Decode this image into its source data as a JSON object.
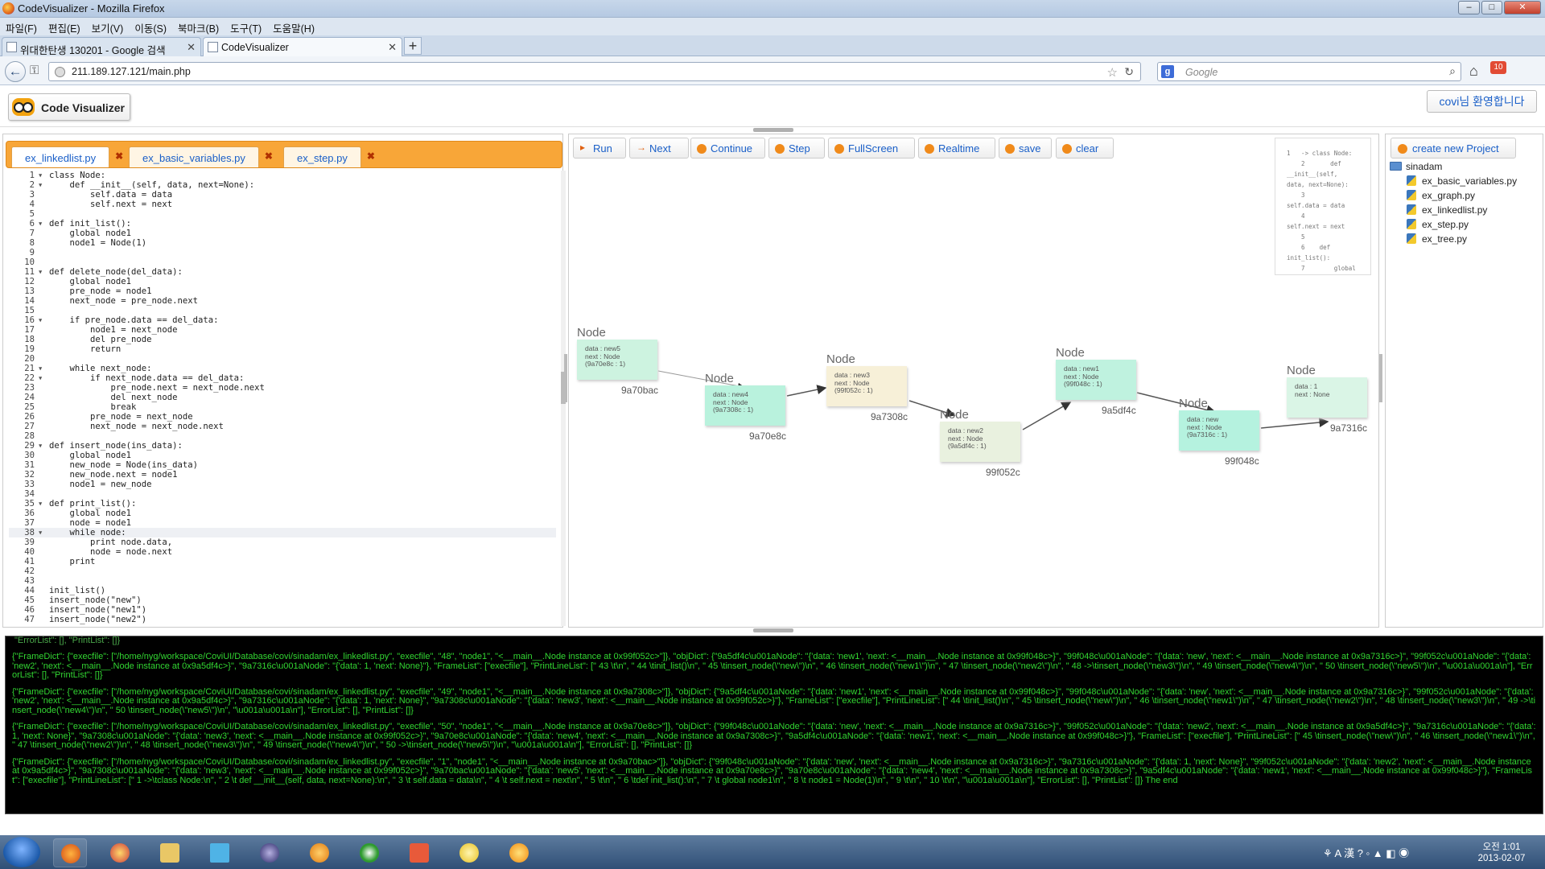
{
  "window": {
    "title": "CodeVisualizer - Mozilla Firefox"
  },
  "menu": [
    "파일(F)",
    "편집(E)",
    "보기(V)",
    "이동(S)",
    "북마크(B)",
    "도구(T)",
    "도움말(H)"
  ],
  "browser_tabs": [
    {
      "label": "위대한탄생 130201 - Google 검색",
      "active": false
    },
    {
      "label": "CodeVisualizer",
      "active": true
    }
  ],
  "address": {
    "url": "211.189.127.121/main.php"
  },
  "search": {
    "placeholder": "Google"
  },
  "notification_count": "10",
  "app": {
    "logo_text": "Code Visualizer",
    "welcome": "covi님 환영합니다"
  },
  "file_tabs": [
    "ex_linkedlist.py",
    "ex_basic_variables.py",
    "ex_step.py"
  ],
  "code_lines": [
    {
      "n": "1",
      "f": "▾",
      "t": "class Node:"
    },
    {
      "n": "2",
      "f": "▾",
      "t": "    def __init__(self, data, next=None):"
    },
    {
      "n": "3",
      "f": "",
      "t": "        self.data = data"
    },
    {
      "n": "4",
      "f": "",
      "t": "        self.next = next"
    },
    {
      "n": "5",
      "f": "",
      "t": ""
    },
    {
      "n": "6",
      "f": "▾",
      "t": "def init_list():"
    },
    {
      "n": "7",
      "f": "",
      "t": "    global node1"
    },
    {
      "n": "8",
      "f": "",
      "t": "    node1 = Node(1)"
    },
    {
      "n": "9",
      "f": "",
      "t": ""
    },
    {
      "n": "10",
      "f": "",
      "t": ""
    },
    {
      "n": "11",
      "f": "▾",
      "t": "def delete_node(del_data):"
    },
    {
      "n": "12",
      "f": "",
      "t": "    global node1"
    },
    {
      "n": "13",
      "f": "",
      "t": "    pre_node = node1"
    },
    {
      "n": "14",
      "f": "",
      "t": "    next_node = pre_node.next"
    },
    {
      "n": "15",
      "f": "",
      "t": ""
    },
    {
      "n": "16",
      "f": "▾",
      "t": "    if pre_node.data == del_data:"
    },
    {
      "n": "17",
      "f": "",
      "t": "        node1 = next_node"
    },
    {
      "n": "18",
      "f": "",
      "t": "        del pre_node"
    },
    {
      "n": "19",
      "f": "",
      "t": "        return"
    },
    {
      "n": "20",
      "f": "",
      "t": ""
    },
    {
      "n": "21",
      "f": "▾",
      "t": "    while next_node:"
    },
    {
      "n": "22",
      "f": "▾",
      "t": "        if next_node.data == del_data:"
    },
    {
      "n": "23",
      "f": "",
      "t": "            pre_node.next = next_node.next"
    },
    {
      "n": "24",
      "f": "",
      "t": "            del next_node"
    },
    {
      "n": "25",
      "f": "",
      "t": "            break"
    },
    {
      "n": "26",
      "f": "",
      "t": "        pre_node = next_node"
    },
    {
      "n": "27",
      "f": "",
      "t": "        next_node = next_node.next"
    },
    {
      "n": "28",
      "f": "",
      "t": ""
    },
    {
      "n": "29",
      "f": "▾",
      "t": "def insert_node(ins_data):"
    },
    {
      "n": "30",
      "f": "",
      "t": "    global node1"
    },
    {
      "n": "31",
      "f": "",
      "t": "    new_node = Node(ins_data)"
    },
    {
      "n": "32",
      "f": "",
      "t": "    new_node.next = node1"
    },
    {
      "n": "33",
      "f": "",
      "t": "    node1 = new_node"
    },
    {
      "n": "34",
      "f": "",
      "t": ""
    },
    {
      "n": "35",
      "f": "▾",
      "t": "def print_list():"
    },
    {
      "n": "36",
      "f": "",
      "t": "    global node1"
    },
    {
      "n": "37",
      "f": "",
      "t": "    node = node1"
    },
    {
      "n": "38",
      "f": "▾",
      "t": "    while node:"
    },
    {
      "n": "39",
      "f": "",
      "t": "        print node.data,"
    },
    {
      "n": "40",
      "f": "",
      "t": "        node = node.next"
    },
    {
      "n": "41",
      "f": "",
      "t": "    print"
    },
    {
      "n": "42",
      "f": "",
      "t": ""
    },
    {
      "n": "43",
      "f": "",
      "t": ""
    },
    {
      "n": "44",
      "f": "",
      "t": "init_list()"
    },
    {
      "n": "45",
      "f": "",
      "t": "insert_node(\"new\")"
    },
    {
      "n": "46",
      "f": "",
      "t": "insert_node(\"new1\")"
    },
    {
      "n": "47",
      "f": "",
      "t": "insert_node(\"new2\")"
    }
  ],
  "highlight_line": "38",
  "toolbar": [
    "Run",
    "Next",
    "Continue",
    "Step",
    "FullScreen",
    "Realtime",
    "save",
    "clear"
  ],
  "minimap_text": "1   -> class Node:\n    2       def\n__init__(self,\ndata, next=None):\n    3\nself.data = data\n    4\nself.next = next\n    5\n    6    def\ninit_list():\n    7        global",
  "nodes": [
    {
      "label": "Node",
      "data": "data : new5",
      "next": "next : Node",
      "ref": "(9a70e8c : 1)",
      "addr": "9a70bac",
      "color": "#cdf3e0"
    },
    {
      "label": "Node",
      "data": "data : new4",
      "next": "next : Node",
      "ref": "(9a7308c : 1)",
      "addr": "9a70e8c",
      "color": "#b9f2dd"
    },
    {
      "label": "Node",
      "data": "data : new3",
      "next": "next : Node",
      "ref": "(99f052c : 1)",
      "addr": "9a7308c",
      "color": "#f7f0d8"
    },
    {
      "label": "Node",
      "data": "data : new2",
      "next": "next : Node",
      "ref": "(9a5df4c : 1)",
      "addr": "99f052c",
      "color": "#e9f1df"
    },
    {
      "label": "Node",
      "data": "data : new1",
      "next": "next : Node",
      "ref": "(99f048c : 1)",
      "addr": "9a5df4c",
      "color": "#bff2df"
    },
    {
      "label": "Node",
      "data": "data : new",
      "next": "next : Node",
      "ref": "(9a7316c : 1)",
      "addr": "99f048c",
      "color": "#b5f2df"
    },
    {
      "label": "Node",
      "data": "data : 1",
      "next": "next : None",
      "ref": "",
      "addr": "9a7316c",
      "color": "#daf5e6"
    }
  ],
  "files": {
    "new_project": "create new Project",
    "folder": "sinadam",
    "items": [
      "ex_basic_variables.py",
      "ex_graph.py",
      "ex_linkedlist.py",
      "ex_step.py",
      "ex_tree.py"
    ]
  },
  "console": {
    "header": "\"ErrorList\": [], \"PrintList\": []}",
    "blocks": [
      "{\"FrameDict\": {\"execfile\": [\"/home/nyg/workspace/CoviUI/Database/covi/sinadam/ex_linkedlist.py\", \"execfile\", \"48\", \"node1\", \"<__main__.Node instance at 0x99f052c>\"]}, \"objDict\": {\"9a5df4c\\u001aNode\": \"{'data': 'new1', 'next': <__main__.Node instance at 0x99f048c>}\", \"99f048c\\u001aNode\": \"{'data': 'new', 'next': <__main__.Node instance at 0x9a7316c>}\", \"99f052c\\u001aNode\": \"{'data': 'new2', 'next': <__main__.Node instance at 0x9a5df4c>}\", \"9a7316c\\u001aNode\": \"{'data': 1, 'next': None}\"}, \"FrameList\": [\"execfile\"], \"PrintLineList\": [\" 43 \\t\\n\", \" 44 \\tinit_list()\\n\", \" 45 \\tinsert_node(\\\"new\\\")\\n\", \" 46 \\tinsert_node(\\\"new1\\\")\\n\", \" 47 \\tinsert_node(\\\"new2\\\")\\n\", \" 48 ->\\tinsert_node(\\\"new3\\\")\\n\", \" 49 \\tinsert_node(\\\"new4\\\")\\n\", \" 50 \\tinsert_node(\\\"new5\\\")\\n\", \"\\u001a\\u001a\\n\"], \"ErrorList\": [], \"PrintList\": []}",
      "{\"FrameDict\": {\"execfile\": [\"/home/nyg/workspace/CoviUI/Database/covi/sinadam/ex_linkedlist.py\", \"execfile\", \"49\", \"node1\", \"<__main__.Node instance at 0x9a7308c>\"]}, \"objDict\": {\"9a5df4c\\u001aNode\": \"{'data': 'new1', 'next': <__main__.Node instance at 0x99f048c>}\", \"99f048c\\u001aNode\": \"{'data': 'new', 'next': <__main__.Node instance at 0x9a7316c>}\", \"99f052c\\u001aNode\": \"{'data': 'new2', 'next': <__main__.Node instance at 0x9a5df4c>}\", \"9a7316c\\u001aNode\": \"{'data': 1, 'next': None}\", \"9a7308c\\u001aNode\": \"{'data': 'new3', 'next': <__main__.Node instance at 0x99f052c>}\"}, \"FrameList\": [\"execfile\"], \"PrintLineList\": [\" 44 \\tinit_list()\\n\", \" 45 \\tinsert_node(\\\"new\\\")\\n\", \" 46 \\tinsert_node(\\\"new1\\\")\\n\", \" 47 \\tinsert_node(\\\"new2\\\")\\n\", \" 48 \\tinsert_node(\\\"new3\\\")\\n\", \" 49 ->\\tinsert_node(\\\"new4\\\")\\n\", \" 50 \\tinsert_node(\\\"new5\\\")\\n\", \"\\u001a\\u001a\\n\"], \"ErrorList\": [], \"PrintList\": []}",
      "{\"FrameDict\": {\"execfile\": [\"/home/nyg/workspace/CoviUI/Database/covi/sinadam/ex_linkedlist.py\", \"execfile\", \"50\", \"node1\", \"<__main__.Node instance at 0x9a70e8c>\"]}, \"objDict\": {\"99f048c\\u001aNode\": \"{'data': 'new', 'next': <__main__.Node instance at 0x9a7316c>}\", \"99f052c\\u001aNode\": \"{'data': 'new2', 'next': <__main__.Node instance at 0x9a5df4c>}\", \"9a7316c\\u001aNode\": \"{'data': 1, 'next': None}\", \"9a7308c\\u001aNode\": \"{'data': 'new3', 'next': <__main__.Node instance at 0x99f052c>}\", \"9a70e8c\\u001aNode\": \"{'data': 'new4', 'next': <__main__.Node instance at 0x9a7308c>}\", \"9a5df4c\\u001aNode\": \"{'data': 'new1', 'next': <__main__.Node instance at 0x99f048c>}\"}, \"FrameList\": [\"execfile\"], \"PrintLineList\": [\" 45 \\tinsert_node(\\\"new\\\")\\n\", \" 46 \\tinsert_node(\\\"new1\\\")\\n\", \" 47 \\tinsert_node(\\\"new2\\\")\\n\", \" 48 \\tinsert_node(\\\"new3\\\")\\n\", \" 49 \\tinsert_node(\\\"new4\\\")\\n\", \" 50 ->\\tinsert_node(\\\"new5\\\")\\n\", \"\\u001a\\u001a\\n\"], \"ErrorList\": [], \"PrintList\": []}",
      "{\"FrameDict\": {\"execfile\": [\"/home/nyg/workspace/CoviUI/Database/covi/sinadam/ex_linkedlist.py\", \"execfile\", \"1\", \"node1\", \"<__main__.Node instance at 0x9a70bac>\"]}, \"objDict\": {\"99f048c\\u001aNode\": \"{'data': 'new', 'next': <__main__.Node instance at 0x9a7316c>}\", \"9a7316c\\u001aNode\": \"{'data': 1, 'next': None}\", \"99f052c\\u001aNode\": \"{'data': 'new2', 'next': <__main__.Node instance at 0x9a5df4c>}\", \"9a7308c\\u001aNode\": \"{'data': 'new3', 'next': <__main__.Node instance at 0x99f052c>}\", \"9a70bac\\u001aNode\": \"{'data': 'new5', 'next': <__main__.Node instance at 0x9a70e8c>}\", \"9a70e8c\\u001aNode\": \"{'data': 'new4', 'next': <__main__.Node instance at 0x9a7308c>}\", \"9a5df4c\\u001aNode\": \"{'data': 'new1', 'next': <__main__.Node instance at 0x99f048c>}\"}, \"FrameList\": [\"execfile\"], \"PrintLineList\": [\" 1 ->\\tclass Node:\\n\", \" 2 \\t def __init__(self, data, next=None):\\n\", \" 3 \\t self.data = data\\n\", \" 4 \\t self.next = next\\n\", \" 5 \\t\\n\", \" 6 \\tdef init_list():\\n\", \" 7 \\t global node1\\n\", \" 8 \\t node1 = Node(1)\\n\", \" 9 \\t\\n\", \" 10 \\t\\n\", \"\\u001a\\u001a\\n\"], \"ErrorList\": [], \"PrintList\": []} The end"
    ]
  },
  "clock": {
    "time": "오전 1:01",
    "date": "2013-02-07"
  }
}
